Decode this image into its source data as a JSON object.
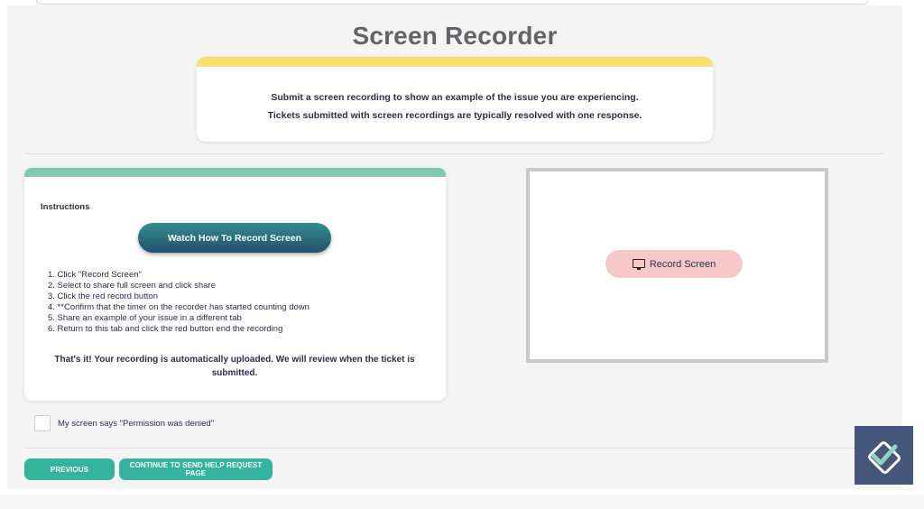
{
  "page": {
    "title": "Screen Recorder"
  },
  "notice": {
    "line1": "Submit a screen recording to show an example of the issue you are experiencing.",
    "line2": "Tickets submitted with screen recordings are typically resolved with one response."
  },
  "instructions": {
    "heading": "Instructions",
    "watch_button": "Watch How To Record Screen",
    "steps": [
      "1. Click \"Record Screen\"",
      "2. Select to share full screen and click share",
      "3. Click the red record button",
      "4. **Confirm that the timer on the recorder has started counting down",
      "5. Share an example of your issue in a different tab",
      "6. Return to this tab and click the red button end the recording"
    ],
    "final_note": "That's it! Your recording is automatically uploaded. We will review when the ticket is submitted."
  },
  "recorder": {
    "record_button": "Record Screen",
    "icon": "monitor-icon"
  },
  "permission": {
    "checkbox_label": "My screen says \"Permission was denied\"",
    "checked": false
  },
  "footer": {
    "previous_button": "PREVIOUS",
    "continue_button": "CONTINUE TO SEND HELP REQUEST PAGE"
  },
  "colors": {
    "notice_stripe": "#f8e06e",
    "instructions_stripe": "#82c8b5",
    "teal_button": "#35b39c",
    "record_button": "#f7c8c8",
    "logo_background": "#45577a"
  }
}
